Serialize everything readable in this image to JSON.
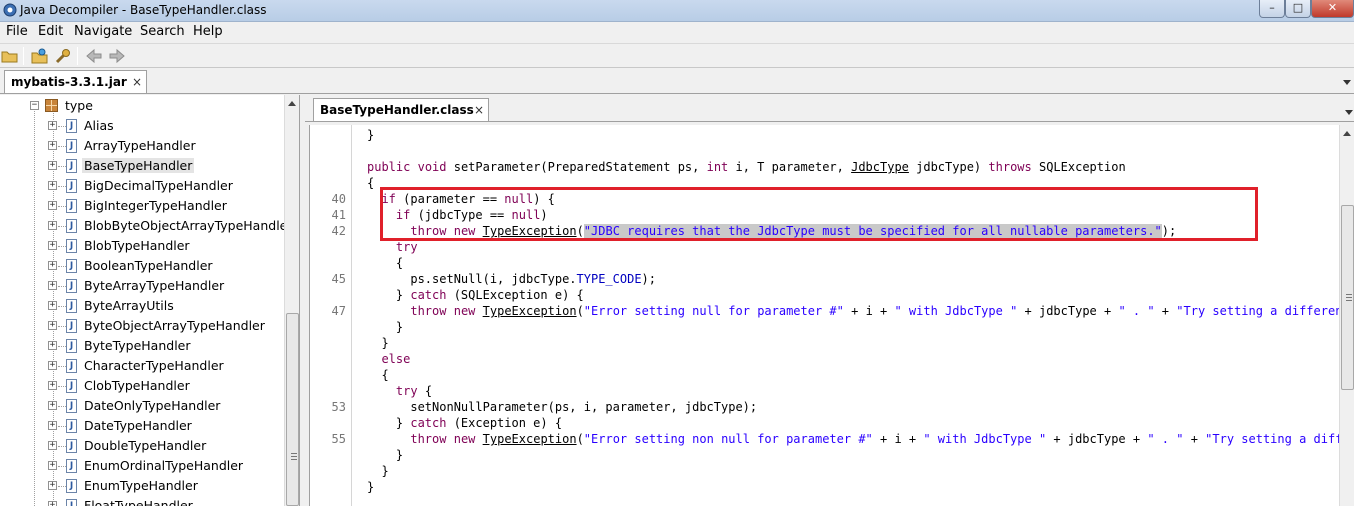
{
  "window": {
    "title": "Java Decompiler - BaseTypeHandler.class",
    "minimize": "–",
    "maximize": "□",
    "close": "✕"
  },
  "menu": [
    "File",
    "Edit",
    "Navigate",
    "Search",
    "Help"
  ],
  "toolbar": {
    "icons": [
      "open-folder-icon",
      "open-file-icon",
      "gear-icon",
      "back-arrow-icon",
      "forward-arrow-icon"
    ]
  },
  "jar_tab": {
    "label": "mybatis-3.3.1.jar",
    "close": "×"
  },
  "tree": {
    "package": "type",
    "items": [
      "Alias",
      "ArrayTypeHandler",
      "BaseTypeHandler",
      "BigDecimalTypeHandler",
      "BigIntegerTypeHandler",
      "BlobByteObjectArrayTypeHandler",
      "BlobTypeHandler",
      "BooleanTypeHandler",
      "ByteArrayTypeHandler",
      "ByteArrayUtils",
      "ByteObjectArrayTypeHandler",
      "ByteTypeHandler",
      "CharacterTypeHandler",
      "ClobTypeHandler",
      "DateOnlyTypeHandler",
      "DateTypeHandler",
      "DoubleTypeHandler",
      "EnumOrdinalTypeHandler",
      "EnumTypeHandler",
      "FloatTypeHandler"
    ],
    "selected": "BaseTypeHandler",
    "expander": "+",
    "package_expander": "−",
    "class_glyph": "J"
  },
  "editor": {
    "tab_label": "BaseTypeHandler.class",
    "tab_close": "×",
    "lines": [
      {
        "n": "",
        "t": [
          [
            "p",
            "}"
          ]
        ]
      },
      {
        "n": "",
        "t": []
      },
      {
        "n": "",
        "t": [
          [
            "k",
            "public"
          ],
          [
            "p",
            " "
          ],
          [
            "k",
            "void"
          ],
          [
            "p",
            " setParameter(PreparedStatement ps, "
          ],
          [
            "k",
            "int"
          ],
          [
            "p",
            " i, T parameter, "
          ],
          [
            "u",
            "JdbcType"
          ],
          [
            "p",
            " jdbcType) "
          ],
          [
            "k",
            "throws"
          ],
          [
            "p",
            " SQLException"
          ]
        ]
      },
      {
        "n": "",
        "t": [
          [
            "p",
            "{"
          ]
        ]
      },
      {
        "n": "40",
        "t": [
          [
            "p",
            "  "
          ],
          [
            "k",
            "if"
          ],
          [
            "p",
            " (parameter == "
          ],
          [
            "k",
            "null"
          ],
          [
            "p",
            ") {"
          ]
        ]
      },
      {
        "n": "41",
        "t": [
          [
            "p",
            "    "
          ],
          [
            "k",
            "if"
          ],
          [
            "p",
            " (jdbcType == "
          ],
          [
            "k",
            "null"
          ],
          [
            "p",
            ")"
          ]
        ]
      },
      {
        "n": "42",
        "t": [
          [
            "p",
            "      "
          ],
          [
            "k",
            "throw"
          ],
          [
            "p",
            " "
          ],
          [
            "k",
            "new"
          ],
          [
            "p",
            " "
          ],
          [
            "u",
            "TypeException"
          ],
          [
            "p",
            "("
          ],
          [
            "ss",
            "\"JDBC requires that the JdbcType must be specified for all nullable parameters.\""
          ],
          [
            "p",
            ");"
          ]
        ]
      },
      {
        "n": "",
        "t": [
          [
            "p",
            "    "
          ],
          [
            "k",
            "try"
          ]
        ]
      },
      {
        "n": "",
        "t": [
          [
            "p",
            "    {"
          ]
        ]
      },
      {
        "n": "45",
        "t": [
          [
            "p",
            "      ps.setNull(i, jdbcType."
          ],
          [
            "f",
            "TYPE_CODE"
          ],
          [
            "p",
            ");"
          ]
        ]
      },
      {
        "n": "",
        "t": [
          [
            "p",
            "    } "
          ],
          [
            "k",
            "catch"
          ],
          [
            "p",
            " (SQLException e) {"
          ]
        ]
      },
      {
        "n": "47",
        "t": [
          [
            "p",
            "      "
          ],
          [
            "k",
            "throw"
          ],
          [
            "p",
            " "
          ],
          [
            "k",
            "new"
          ],
          [
            "p",
            " "
          ],
          [
            "u",
            "TypeException"
          ],
          [
            "p",
            "("
          ],
          [
            "s",
            "\"Error setting null for parameter #\""
          ],
          [
            "p",
            " + i + "
          ],
          [
            "s",
            "\" with JdbcType \""
          ],
          [
            "p",
            " + jdbcType + "
          ],
          [
            "s",
            "\" . \""
          ],
          [
            "p",
            " + "
          ],
          [
            "s",
            "\"Try setting a different Jd"
          ]
        ]
      },
      {
        "n": "",
        "t": [
          [
            "p",
            "    }"
          ]
        ]
      },
      {
        "n": "",
        "t": [
          [
            "p",
            "  }"
          ]
        ]
      },
      {
        "n": "",
        "t": [
          [
            "p",
            "  "
          ],
          [
            "k",
            "else"
          ]
        ]
      },
      {
        "n": "",
        "t": [
          [
            "p",
            "  {"
          ]
        ]
      },
      {
        "n": "",
        "t": [
          [
            "p",
            "    "
          ],
          [
            "k",
            "try"
          ],
          [
            "p",
            " {"
          ]
        ]
      },
      {
        "n": "53",
        "t": [
          [
            "p",
            "      setNonNullParameter(ps, i, parameter, jdbcType);"
          ]
        ]
      },
      {
        "n": "",
        "t": [
          [
            "p",
            "    } "
          ],
          [
            "k",
            "catch"
          ],
          [
            "p",
            " (Exception e) {"
          ]
        ]
      },
      {
        "n": "55",
        "t": [
          [
            "p",
            "      "
          ],
          [
            "k",
            "throw"
          ],
          [
            "p",
            " "
          ],
          [
            "k",
            "new"
          ],
          [
            "p",
            " "
          ],
          [
            "u",
            "TypeException"
          ],
          [
            "p",
            "("
          ],
          [
            "s",
            "\"Error setting non null for parameter #\""
          ],
          [
            "p",
            " + i + "
          ],
          [
            "s",
            "\" with JdbcType \""
          ],
          [
            "p",
            " + jdbcType + "
          ],
          [
            "s",
            "\" . \""
          ],
          [
            "p",
            " + "
          ],
          [
            "s",
            "\"Try setting a differen"
          ]
        ]
      },
      {
        "n": "",
        "t": [
          [
            "p",
            "    }"
          ]
        ]
      },
      {
        "n": "",
        "t": [
          [
            "p",
            "  }"
          ]
        ]
      },
      {
        "n": "",
        "t": [
          [
            "p",
            "}"
          ]
        ]
      }
    ]
  },
  "colors": {
    "keyword": "#7f0055",
    "string": "#2a00ff",
    "field": "#0000c0",
    "highlight_box": "#e0202a",
    "selection": "#c9c9c9"
  }
}
